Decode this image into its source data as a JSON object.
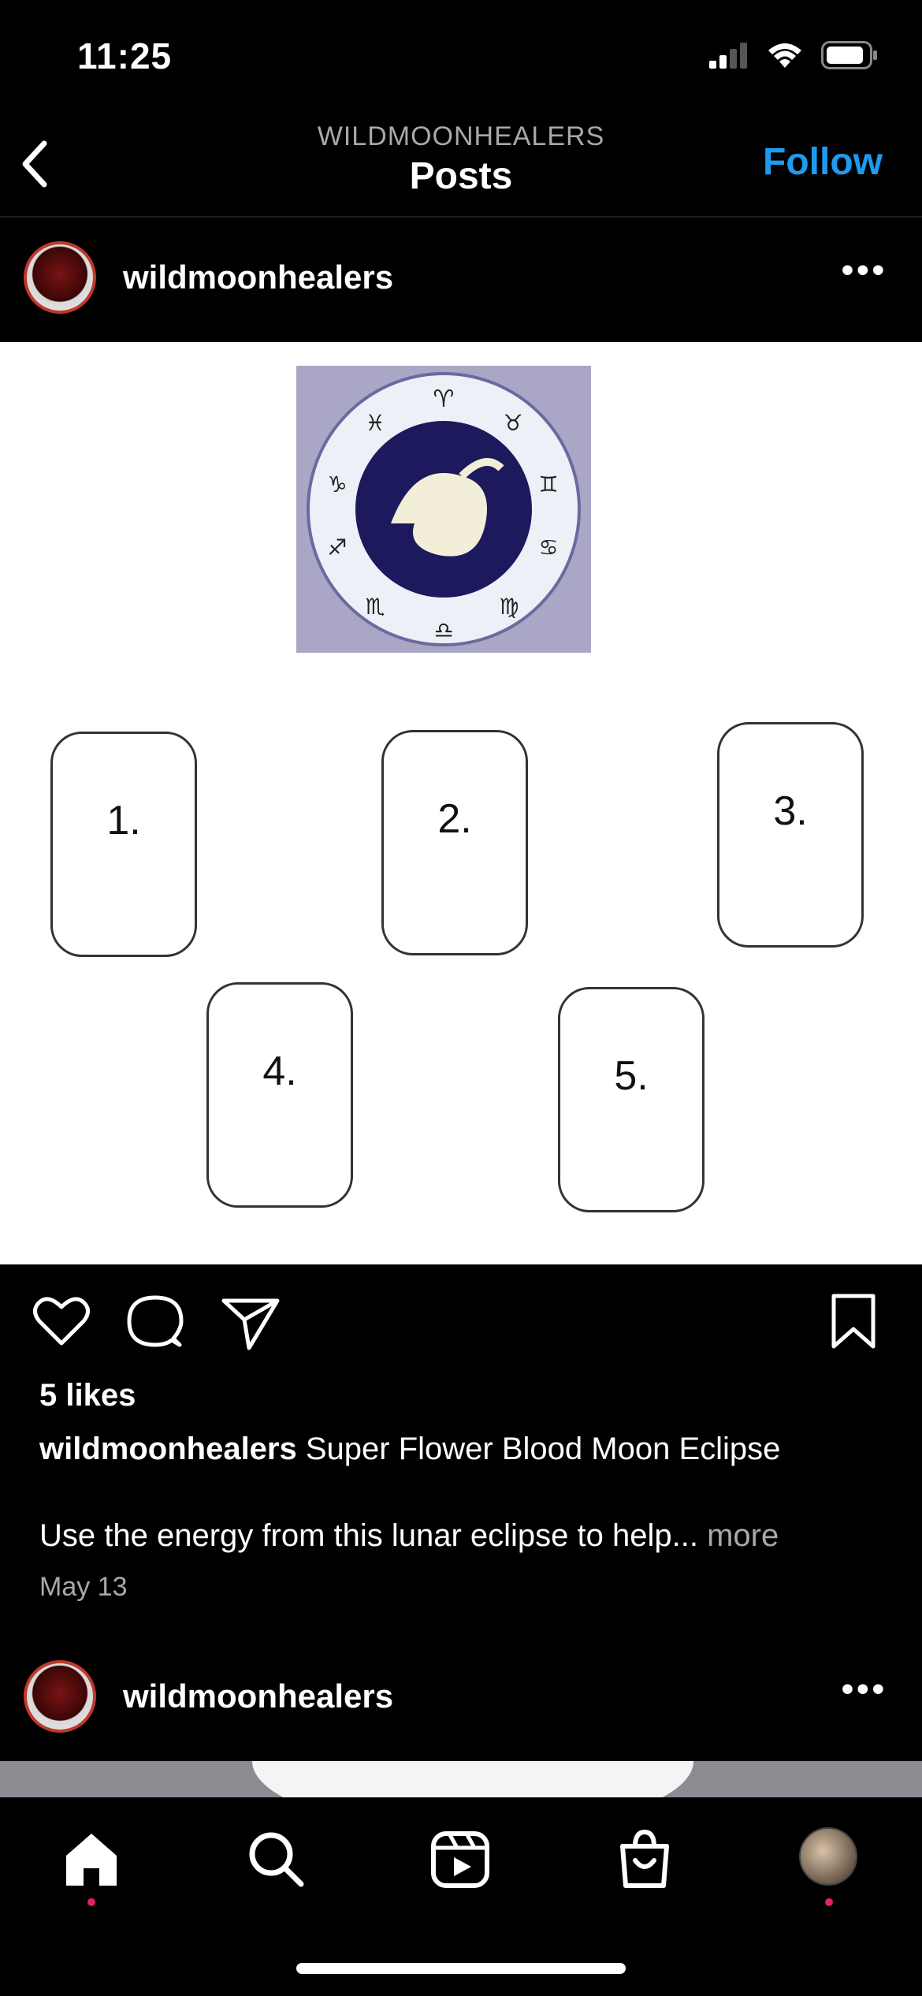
{
  "status_bar": {
    "time": "11:25",
    "icons": [
      "signal-icon",
      "wifi-icon",
      "battery-icon"
    ]
  },
  "header": {
    "subtitle": "WILDMOONHEALERS",
    "title": "Posts",
    "follow_label": "Follow",
    "back_icon": "chevron-left-icon"
  },
  "post": {
    "username": "wildmoonhealers",
    "image": {
      "cards": [
        "1.",
        "2.",
        "3.",
        "4.",
        "5."
      ]
    },
    "likes": "5 likes",
    "caption_user": "wildmoonhealers",
    "caption_text": "Super Flower Blood Moon Eclipse",
    "caption_line2": "Use the energy from this lunar eclipse to help...",
    "more_label": "more",
    "date": "May 13"
  },
  "next_post": {
    "username": "wildmoonhealers"
  },
  "tabbar": {
    "items": [
      "home-icon",
      "search-icon",
      "reels-icon",
      "shop-icon",
      "profile-avatar"
    ]
  },
  "colors": {
    "accent": "#1d9bf0",
    "notification_dot": "#e0245e",
    "background": "#000000"
  }
}
